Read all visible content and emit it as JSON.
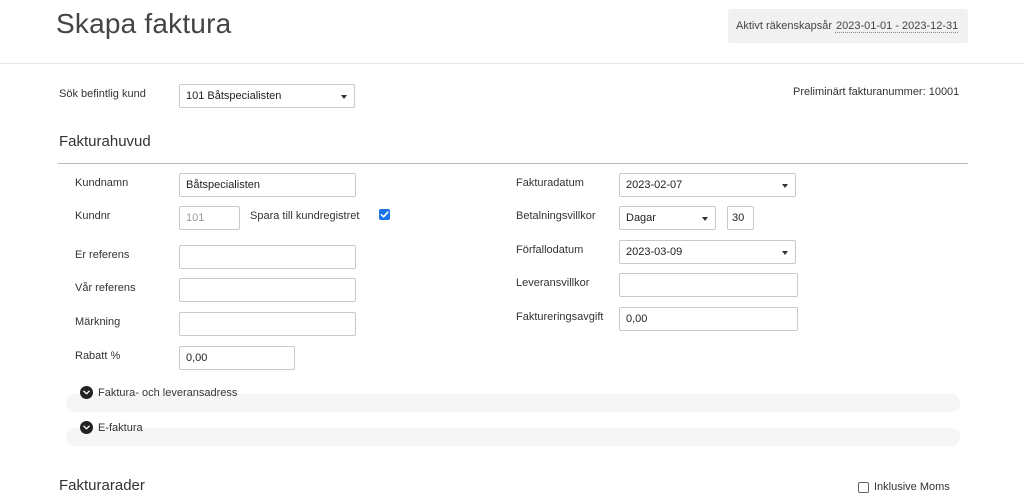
{
  "header": {
    "title": "Skapa faktura",
    "fiscal_year_label": "Aktivt räkenskapsår",
    "fiscal_year_range": "2023-01-01 - 2023-12-31"
  },
  "customer_search": {
    "label": "Sök befintlig kund",
    "selected": "101 Båtspecialisten"
  },
  "preliminary_invoice_number": "Preliminärt fakturanummer: 10001",
  "invoice_header": {
    "title": "Fakturahuvud",
    "left": {
      "customer_name_label": "Kundnamn",
      "customer_name_value": "Båtspecialisten",
      "customer_no_label": "Kundnr",
      "customer_no_value": "101",
      "save_to_register_label": "Spara till kundregistret",
      "save_to_register_checked": true,
      "your_reference_label": "Er referens",
      "your_reference_value": "",
      "our_reference_label": "Vår referens",
      "our_reference_value": "",
      "marking_label": "Märkning",
      "marking_value": "",
      "discount_label": "Rabatt %",
      "discount_value": "0,00"
    },
    "right": {
      "invoice_date_label": "Fakturadatum",
      "invoice_date_value": "2023-02-07",
      "payment_terms_label": "Betalningsvillkor",
      "payment_terms_unit": "Dagar",
      "payment_terms_days": "30",
      "due_date_label": "Förfallodatum",
      "due_date_value": "2023-03-09",
      "delivery_terms_label": "Leveransvillkor",
      "delivery_terms_value": "",
      "invoicing_fee_label": "Faktureringsavgift",
      "invoicing_fee_value": "0,00"
    }
  },
  "collapsibles": {
    "address": "Faktura- och leveransadress",
    "efaktura": "E-faktura"
  },
  "invoice_rows": {
    "title": "Fakturarader",
    "incl_vat_label": "Inklusive Moms",
    "incl_vat_checked": false
  },
  "colors": {
    "accent": "#1a73e8",
    "divider": "#bdbdbd",
    "fiscal_bg": "#f1f1f1"
  },
  "icons": {
    "dropdown": "caret-down-icon",
    "check": "checkmark-icon",
    "expand": "chevron-down-circle-icon"
  }
}
